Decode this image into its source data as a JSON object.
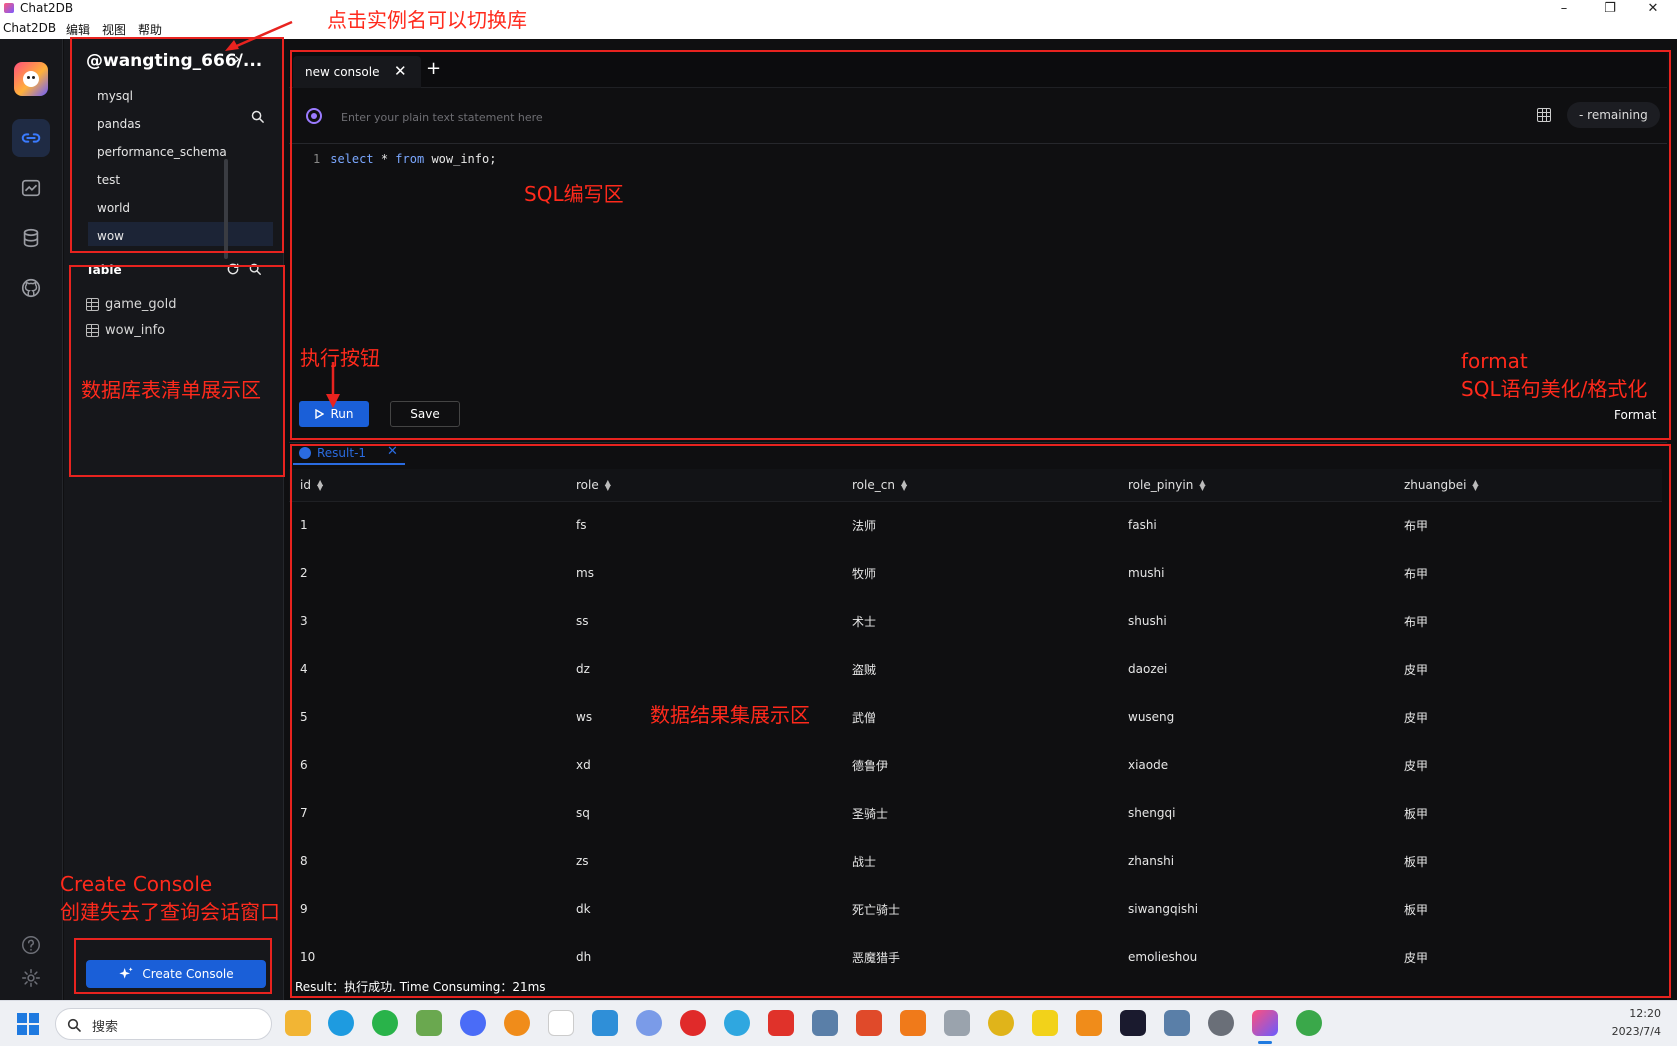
{
  "window": {
    "title": "Chat2DB",
    "buttons": [
      "–",
      "❐",
      "✕"
    ]
  },
  "menu": {
    "items": [
      "Chat2DB",
      "编辑",
      "视图",
      "帮助"
    ]
  },
  "sidebar": {
    "instance_title": "@wangting_666/...",
    "instance_arrow": "›",
    "databases": [
      "mysql",
      "pandas",
      "performance_schema",
      "test",
      "world",
      "wow"
    ],
    "selected_database": "wow",
    "table_heading": "Table",
    "tables": [
      "game_gold",
      "wow_info"
    ],
    "create_console_label": "Create Console"
  },
  "editor": {
    "tab_label": "new console",
    "ai_placeholder": "Enter your plain text statement here",
    "remaining_label": "- remaining",
    "code": {
      "line_no": "1",
      "kw1": "select",
      "star": "*",
      "kw2": "from",
      "table": "wow_info",
      "semi": ";"
    },
    "run_label": "Run",
    "save_label": "Save",
    "format_label": "Format"
  },
  "result": {
    "tab_label": "Result-1",
    "columns": [
      "id",
      "role",
      "role_cn",
      "role_pinyin",
      "zhuangbei"
    ],
    "rows": [
      [
        "1",
        "fs",
        "法师",
        "fashi",
        "布甲"
      ],
      [
        "2",
        "ms",
        "牧师",
        "mushi",
        "布甲"
      ],
      [
        "3",
        "ss",
        "术士",
        "shushi",
        "布甲"
      ],
      [
        "4",
        "dz",
        "盗贼",
        "daozei",
        "皮甲"
      ],
      [
        "5",
        "ws",
        "武僧",
        "wuseng",
        "皮甲"
      ],
      [
        "6",
        "xd",
        "德鲁伊",
        "xiaode",
        "皮甲"
      ],
      [
        "7",
        "sq",
        "圣骑士",
        "shengqi",
        "板甲"
      ],
      [
        "8",
        "zs",
        "战士",
        "zhanshi",
        "板甲"
      ],
      [
        "9",
        "dk",
        "死亡骑士",
        "siwangqishi",
        "板甲"
      ],
      [
        "10",
        "dh",
        "恶魔猎手",
        "emolieshou",
        "皮甲"
      ]
    ],
    "status": "Result：执行成功. Time Consuming：21ms"
  },
  "annotations": {
    "switch_db": "点击实例名可以切换库",
    "sql_area": "SQL编写区",
    "run_button": "执行按钮",
    "format_1": "format",
    "format_2": "SQL语句美化/格式化",
    "table_list": "数据库表清单展示区",
    "result_area": "数据结果集展示区",
    "create_console_1": "Create Console",
    "create_console_2": "创建失去了查询会话窗口"
  },
  "taskbar": {
    "search_label": "搜索",
    "time": "12:20",
    "date": "2023/7/4"
  },
  "colors": {
    "accent": "#1a5fd8",
    "annotation": "#e8231f",
    "background": "#0f0f11"
  }
}
